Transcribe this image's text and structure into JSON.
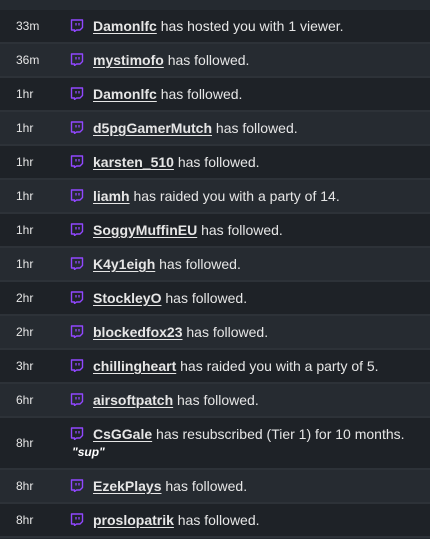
{
  "events": [
    {
      "time": "33m",
      "user": "Damonlfc",
      "text": "has hosted you with 1 viewer."
    },
    {
      "time": "36m",
      "user": "mystimofo",
      "text": "has followed."
    },
    {
      "time": "1hr",
      "user": "Damonlfc",
      "text": "has followed."
    },
    {
      "time": "1hr",
      "user": "d5pgGamerMutch",
      "text": "has followed."
    },
    {
      "time": "1hr",
      "user": "karsten_510",
      "text": "has followed."
    },
    {
      "time": "1hr",
      "user": "liamh",
      "text": "has raided you with a party of 14."
    },
    {
      "time": "1hr",
      "user": "SoggyMuffinEU",
      "text": "has followed."
    },
    {
      "time": "1hr",
      "user": "K4y1eigh",
      "text": "has followed."
    },
    {
      "time": "2hr",
      "user": "StockleyO",
      "text": "has followed."
    },
    {
      "time": "2hr",
      "user": "blockedfox23",
      "text": "has followed."
    },
    {
      "time": "3hr",
      "user": "chillingheart",
      "text": "has raided you with a party of 5."
    },
    {
      "time": "6hr",
      "user": "airsoftpatch",
      "text": "has followed."
    },
    {
      "time": "8hr",
      "user": "CsGGale",
      "text": "has resubscribed (Tier 1) for 10 months.",
      "message": "\"sup\""
    },
    {
      "time": "8hr",
      "user": "EzekPlays",
      "text": "has followed."
    },
    {
      "time": "8hr",
      "user": "proslopatrik",
      "text": "has followed."
    }
  ],
  "colors": {
    "icon": "#9147ff",
    "row_dark": "#1e2227",
    "row_light": "#262b31",
    "text": "#e6e6e6"
  },
  "icon_name": "twitch-chat-icon"
}
